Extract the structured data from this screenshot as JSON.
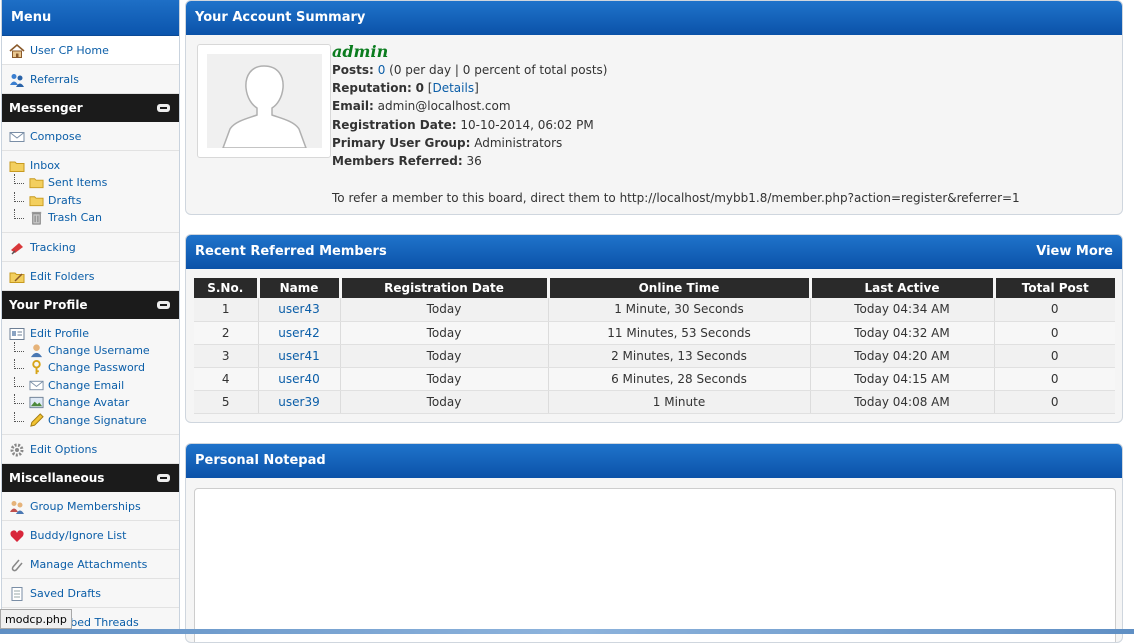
{
  "sidebar": {
    "title": "Menu",
    "items_top": [
      {
        "label": "User CP Home",
        "icon": "home-icon"
      },
      {
        "label": "Referrals",
        "icon": "users-icon"
      }
    ],
    "messenger": {
      "title": "Messenger",
      "compose": "Compose",
      "inbox": "Inbox",
      "subitems": [
        "Sent Items",
        "Drafts",
        "Trash Can"
      ],
      "tracking": "Tracking",
      "edit_folders": "Edit Folders"
    },
    "profile": {
      "title": "Your Profile",
      "edit_profile": "Edit Profile",
      "subitems": [
        "Change Username",
        "Change Password",
        "Change Email",
        "Change Avatar",
        "Change Signature"
      ],
      "edit_options": "Edit Options"
    },
    "misc": {
      "title": "Miscellaneous",
      "items": [
        "Group Memberships",
        "Buddy/Ignore List",
        "Manage Attachments",
        "Saved Drafts",
        "Subscribed Threads"
      ]
    }
  },
  "summary": {
    "title": "Your Account Summary",
    "username": "admin",
    "posts_label": "Posts:",
    "posts_value": "0",
    "posts_detail": "(0 per day | 0 percent of total posts)",
    "reputation_label": "Reputation:",
    "reputation_value": "0",
    "reputation_details": "Details",
    "email_label": "Email:",
    "email_value": "admin@localhost.com",
    "regdate_label": "Registration Date:",
    "regdate_value": "10-10-2014, 06:02 PM",
    "group_label": "Primary User Group:",
    "group_value": "Administrators",
    "referred_label": "Members Referred:",
    "referred_value": "36",
    "refer_text": "To refer a member to this board, direct them to http://localhost/mybb1.8/member.php?action=register&referrer=1"
  },
  "referred": {
    "title": "Recent Referred Members",
    "view_more": "View More",
    "columns": [
      "S.No.",
      "Name",
      "Registration Date",
      "Online Time",
      "Last Active",
      "Total Post"
    ],
    "rows": [
      [
        "1",
        "user43",
        "Today",
        "1 Minute, 30 Seconds",
        "Today 04:34 AM",
        "0"
      ],
      [
        "2",
        "user42",
        "Today",
        "11 Minutes, 53 Seconds",
        "Today 04:32 AM",
        "0"
      ],
      [
        "3",
        "user41",
        "Today",
        "2 Minutes, 13 Seconds",
        "Today 04:20 AM",
        "0"
      ],
      [
        "4",
        "user40",
        "Today",
        "6 Minutes, 28 Seconds",
        "Today 04:15 AM",
        "0"
      ],
      [
        "5",
        "user39",
        "Today",
        "1 Minute",
        "Today 04:08 AM",
        "0"
      ]
    ]
  },
  "notepad": {
    "title": "Personal Notepad"
  },
  "status_tip": "modcp.php",
  "colors": {
    "header_blue": "#0b55ad",
    "category_black": "#1b1b1b",
    "link_blue": "#0b5ea8",
    "username_green": "#0a7c1e"
  }
}
